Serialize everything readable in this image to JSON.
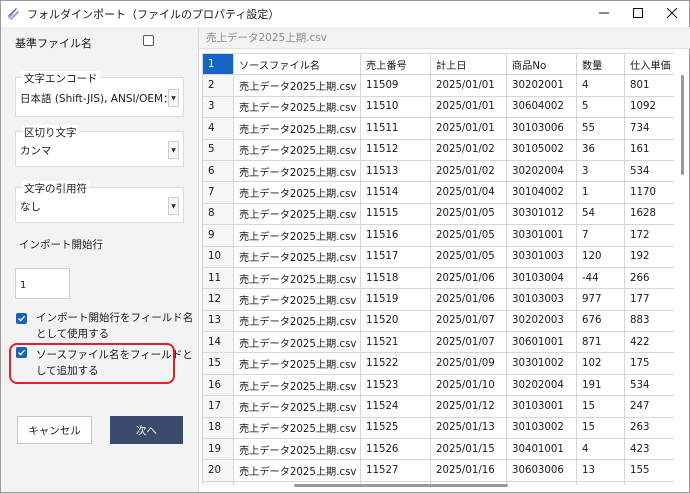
{
  "window": {
    "title": "フォルダインポート（ファイルのプロパティ設定）",
    "controls": [
      "minimize-icon",
      "maximize-icon",
      "close-icon"
    ]
  },
  "left_panel": {
    "base_filename_label": "基準ファイル名",
    "base_filename_checked": false,
    "encoding": {
      "label": "文字エンコード",
      "value": "日本語 (Shift-JIS), ANSI/OEM：S"
    },
    "delimiter": {
      "label": "区切り文字",
      "value": "カンマ"
    },
    "quote": {
      "label": "文字の引用符",
      "value": "なし"
    },
    "start_row": {
      "label": "インポート開始行",
      "value": "1"
    },
    "use_header": {
      "line1": "インポート開始行をフィールド名",
      "line2": "として使用する",
      "checked": true
    },
    "add_source": {
      "line1": "ソースファイル名をフィールドと",
      "line2": "して追加する",
      "checked": true
    },
    "cancel_label": "キャンセル",
    "next_label": "次へ"
  },
  "file_tab": "売上データ2025上期.csv",
  "grid": {
    "header": {
      "row": "1",
      "cells": [
        "ソースファイル名",
        "売上番号",
        "計上日",
        "商品No",
        "数量",
        "仕入単価"
      ]
    },
    "rows": [
      {
        "n": "2",
        "c": [
          "売上データ2025上期.csv",
          "11509",
          "2025/01/01",
          "30202001",
          "4",
          "801"
        ]
      },
      {
        "n": "3",
        "c": [
          "売上データ2025上期.csv",
          "11510",
          "2025/01/01",
          "30604002",
          "5",
          "1092"
        ]
      },
      {
        "n": "4",
        "c": [
          "売上データ2025上期.csv",
          "11511",
          "2025/01/01",
          "30103006",
          "55",
          "734"
        ]
      },
      {
        "n": "5",
        "c": [
          "売上データ2025上期.csv",
          "11512",
          "2025/01/02",
          "30105002",
          "36",
          "161"
        ]
      },
      {
        "n": "6",
        "c": [
          "売上データ2025上期.csv",
          "11513",
          "2025/01/02",
          "30202004",
          "3",
          "534"
        ]
      },
      {
        "n": "7",
        "c": [
          "売上データ2025上期.csv",
          "11514",
          "2025/01/04",
          "30104002",
          "1",
          "1170"
        ]
      },
      {
        "n": "8",
        "c": [
          "売上データ2025上期.csv",
          "11515",
          "2025/01/05",
          "30301012",
          "54",
          "1628"
        ]
      },
      {
        "n": "9",
        "c": [
          "売上データ2025上期.csv",
          "11516",
          "2025/01/05",
          "30301001",
          "7",
          "172"
        ]
      },
      {
        "n": "10",
        "c": [
          "売上データ2025上期.csv",
          "11517",
          "2025/01/05",
          "30301003",
          "120",
          "192"
        ]
      },
      {
        "n": "11",
        "c": [
          "売上データ2025上期.csv",
          "11518",
          "2025/01/06",
          "30103004",
          "-44",
          "266"
        ]
      },
      {
        "n": "12",
        "c": [
          "売上データ2025上期.csv",
          "11519",
          "2025/01/06",
          "30103003",
          "977",
          "177"
        ]
      },
      {
        "n": "13",
        "c": [
          "売上データ2025上期.csv",
          "11520",
          "2025/01/07",
          "30202003",
          "676",
          "883"
        ]
      },
      {
        "n": "14",
        "c": [
          "売上データ2025上期.csv",
          "11521",
          "2025/01/07",
          "30601001",
          "871",
          "422"
        ]
      },
      {
        "n": "15",
        "c": [
          "売上データ2025上期.csv",
          "11522",
          "2025/01/09",
          "30301002",
          "102",
          "175"
        ]
      },
      {
        "n": "16",
        "c": [
          "売上データ2025上期.csv",
          "11523",
          "2025/01/10",
          "30202004",
          "191",
          "534"
        ]
      },
      {
        "n": "17",
        "c": [
          "売上データ2025上期.csv",
          "11524",
          "2025/01/12",
          "30103001",
          "15",
          "247"
        ]
      },
      {
        "n": "18",
        "c": [
          "売上データ2025上期.csv",
          "11525",
          "2025/01/13",
          "30103002",
          "15",
          "263"
        ]
      },
      {
        "n": "19",
        "c": [
          "売上データ2025上期.csv",
          "11526",
          "2025/01/15",
          "30401001",
          "4",
          "423"
        ]
      },
      {
        "n": "20",
        "c": [
          "売上データ2025上期.csv",
          "11527",
          "2025/01/16",
          "30603006",
          "13",
          "155"
        ]
      },
      {
        "n": "21",
        "c": [
          "売上データ2025上期.csv",
          "11528",
          "2025/01/16",
          "30602002",
          "21",
          "227"
        ]
      }
    ]
  },
  "colors": {
    "accent": "#1764c4",
    "next_button": "#3b4b6c",
    "highlight": "#e0222b"
  }
}
